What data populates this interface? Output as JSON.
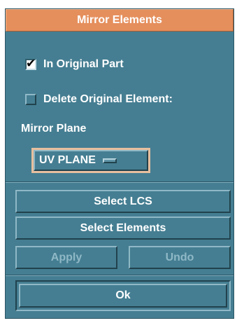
{
  "dialog": {
    "title": "Mirror Elements",
    "in_original_part": {
      "label": "In Original Part",
      "checked": true
    },
    "delete_original": {
      "label": "Delete Original Element:",
      "checked": false
    },
    "mirror_plane_label": "Mirror Plane",
    "mirror_plane_value": "UV PLANE",
    "buttons": {
      "select_lcs": "Select LCS",
      "select_elements": "Select Elements",
      "apply": "Apply",
      "undo": "Undo",
      "ok": "Ok"
    }
  },
  "colors": {
    "panel": "#457e92",
    "title_bar": "#e58f5d",
    "option_frame": "#e6bf9e",
    "text": "#ffffff",
    "disabled_text": "#8fb8c6"
  }
}
